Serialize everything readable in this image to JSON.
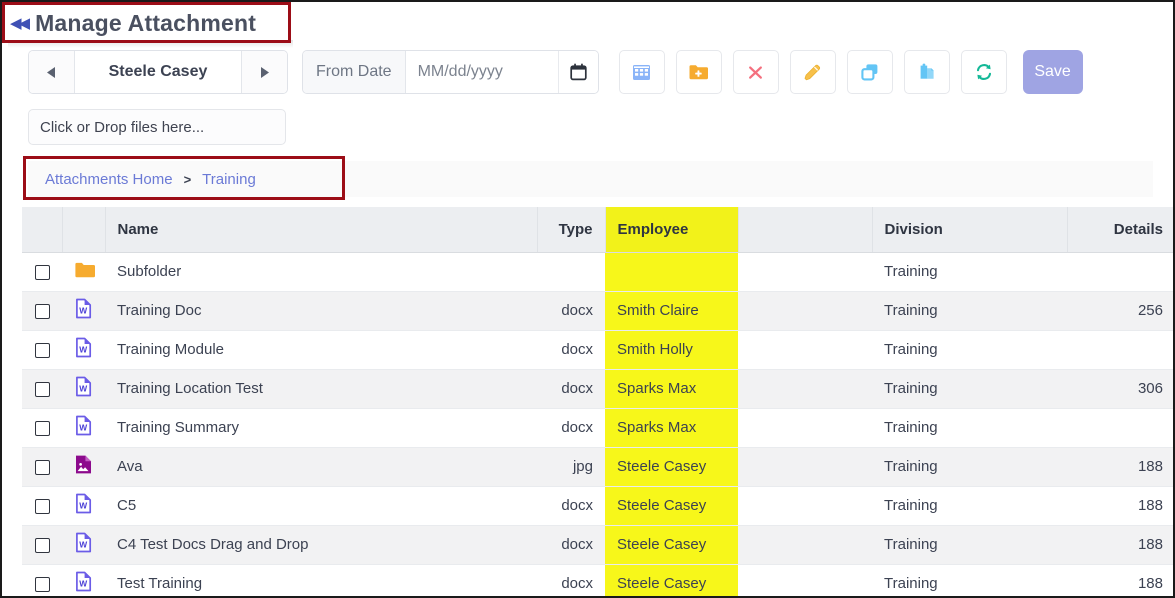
{
  "window": {
    "title": "Manage Attachment",
    "collapse_icon": "collapse-left-icon"
  },
  "toolbar": {
    "prev_icon": "triangle-left-icon",
    "next_icon": "triangle-right-icon",
    "employee_selector_value": "Steele Casey",
    "date_prefix_label": "From Date",
    "date_value": "",
    "date_placeholder": "MM/dd/yyyy",
    "calendar_icon": "calendar-icon",
    "buttons": [
      {
        "name": "grid-view-button",
        "icon": "grid-icon",
        "color": "#8ab4f8"
      },
      {
        "name": "new-folder-button",
        "icon": "folder-plus-icon",
        "color": "#f6ab2f"
      },
      {
        "name": "delete-button",
        "icon": "close-x-icon",
        "color": "#f4707f"
      },
      {
        "name": "edit-button",
        "icon": "pencil-icon",
        "color": "#f7c04a"
      },
      {
        "name": "copy-button",
        "icon": "copy-icon",
        "color": "#63c5f5"
      },
      {
        "name": "paste-button",
        "icon": "paste-icon",
        "color": "#63c5f5"
      },
      {
        "name": "refresh-button",
        "icon": "refresh-icon",
        "color": "#13b897"
      }
    ],
    "save_label": "Save"
  },
  "dropzone": {
    "label": "Click or Drop files here..."
  },
  "breadcrumb": {
    "home_label": "Attachments Home",
    "separator": ">",
    "current_label": "Training"
  },
  "table": {
    "columns": [
      "",
      "",
      "Name",
      "Type",
      "Employee",
      "",
      "Division",
      "Details"
    ],
    "headers": {
      "name": "Name",
      "type": "Type",
      "employee": "Employee",
      "blank": "",
      "division": "Division",
      "details": "Details"
    },
    "rows": [
      {
        "icon": "folder-icon",
        "name": "Subfolder",
        "type": "",
        "employee": "",
        "division": "Training",
        "details": ""
      },
      {
        "icon": "word-file-icon",
        "name": "Training Doc",
        "type": "docx",
        "employee": "Smith Claire",
        "division": "Training",
        "details": "256"
      },
      {
        "icon": "word-file-icon",
        "name": "Training Module",
        "type": "docx",
        "employee": "Smith Holly",
        "division": "Training",
        "details": ""
      },
      {
        "icon": "word-file-icon",
        "name": "Training Location Test",
        "type": "docx",
        "employee": "Sparks Max",
        "division": "Training",
        "details": "306"
      },
      {
        "icon": "word-file-icon",
        "name": "Training Summary",
        "type": "docx",
        "employee": "Sparks Max",
        "division": "Training",
        "details": ""
      },
      {
        "icon": "image-file-icon",
        "name": "Ava",
        "type": "jpg",
        "employee": "Steele Casey",
        "division": "Training",
        "details": "188"
      },
      {
        "icon": "word-file-icon",
        "name": "C5",
        "type": "docx",
        "employee": "Steele Casey",
        "division": "Training",
        "details": "188"
      },
      {
        "icon": "word-file-icon",
        "name": "C4 Test Docs Drag and Drop",
        "type": "docx",
        "employee": "Steele Casey",
        "division": "Training",
        "details": "188"
      },
      {
        "icon": "word-file-icon",
        "name": "Test Training",
        "type": "docx",
        "employee": "Steele Casey",
        "division": "Training",
        "details": "188"
      }
    ]
  },
  "highlights": {
    "color": "#9c0d17",
    "regions": [
      "title-highlight",
      "breadcrumb-highlight"
    ]
  },
  "colors": {
    "employee_column_highlight": "#f7f71a",
    "save_button": "#9fa4e3",
    "link": "#6b7ad6",
    "header_bg": "#eceef1"
  }
}
